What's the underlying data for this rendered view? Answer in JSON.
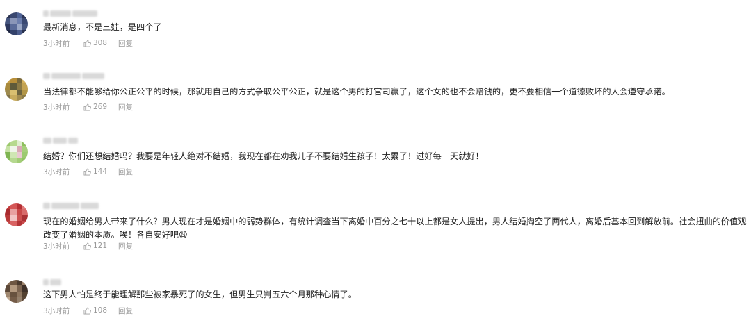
{
  "comments": [
    {
      "text": "最新消息，不是三娃，是四个了",
      "time": "3小时前",
      "likes": "308",
      "reply_label": "回复",
      "avatar_colors": [
        "#2b3350",
        "#3a4870",
        "#4f6396",
        "#2d3656",
        "#45557e",
        "#8a96b8",
        "#6d7fae",
        "#3b4a73",
        "#2c375c",
        "#5a6b99",
        "#9aa7c6",
        "#47577f",
        "#1f2742",
        "#33416a",
        "#4c5d8d",
        "#28324f"
      ]
    },
    {
      "text": "当法律都不能够给你公正公平的时候，那就用自己的方式争取公平公正，就是这个男的打官司赢了，这个女的也不会赔钱的，更不要相信一个道德败坏的人会遵守承诺。",
      "time": "3小时前",
      "likes": "269",
      "reply_label": "回复",
      "avatar_colors": [
        "#c9a24a",
        "#b88f3a",
        "#7a6a3c",
        "#d6b25c",
        "#a88a3c",
        "#5f5a3a",
        "#8c7a45",
        "#c4a352",
        "#9d8a4e",
        "#d9bf70",
        "#6c6440",
        "#b29647",
        "#7f7248",
        "#c7ab5d",
        "#a28c50",
        "#8b7b47"
      ]
    },
    {
      "text": "结婚？你们还想结婚吗？我要是年轻人绝对不结婚，我现在都在劝我儿子不要结婚生孩子！太累了！过好每一天就好！",
      "time": "3小时前",
      "likes": "144",
      "reply_label": "回复",
      "avatar_colors": [
        "#9bc86c",
        "#b6d98d",
        "#e0efcf",
        "#8fbf5e",
        "#c6e2a4",
        "#f0f5ea",
        "#d9a9b4",
        "#a7cf7c",
        "#7fb552",
        "#cfe6b3",
        "#e8c9d0",
        "#9cca70",
        "#86bb58",
        "#b5d88f",
        "#a2cc76",
        "#91c262"
      ]
    },
    {
      "text": "现在的婚姻给男人带来了什么？男人现在才是婚姻中的弱势群体，有统计调查当下离婚中百分之七十以上都是女人提出，男人结婚掏空了两代人，离婚后基本回到解放前。社会扭曲的价值观改变了婚姻的本质。唉！各自安好吧",
      "emoji": "😩",
      "time": "3小时前",
      "likes": "121",
      "reply_label": "回复",
      "avatar_colors": [
        "#c23a3a",
        "#d45656",
        "#b52f33",
        "#e07b7b",
        "#a82a2e",
        "#e8a0a0",
        "#c84848",
        "#d86a6a",
        "#b83838",
        "#f2c4c4",
        "#cc5050",
        "#a93034",
        "#c24545",
        "#d86262",
        "#b43437",
        "#c84a4a"
      ]
    },
    {
      "text": "这下男人怕是终于能理解那些被家暴死了的女生，但男生只判五六个月那种心情了。",
      "time": "3小时前",
      "likes": "108",
      "reply_label": "回复",
      "avatar_colors": [
        "#8a7058",
        "#6e5642",
        "#4a3a2e",
        "#9c826a",
        "#5c4838",
        "#b49a80",
        "#7c6450",
        "#3e3028",
        "#a08870",
        "#68523f",
        "#8e7660",
        "#52402f",
        "#c0a890",
        "#745c48",
        "#94806c",
        "#5a4636"
      ]
    }
  ],
  "icons": {
    "like": "thumbs-up-icon"
  },
  "colors": {
    "meta_text": "#999999",
    "body_text": "#222222"
  }
}
